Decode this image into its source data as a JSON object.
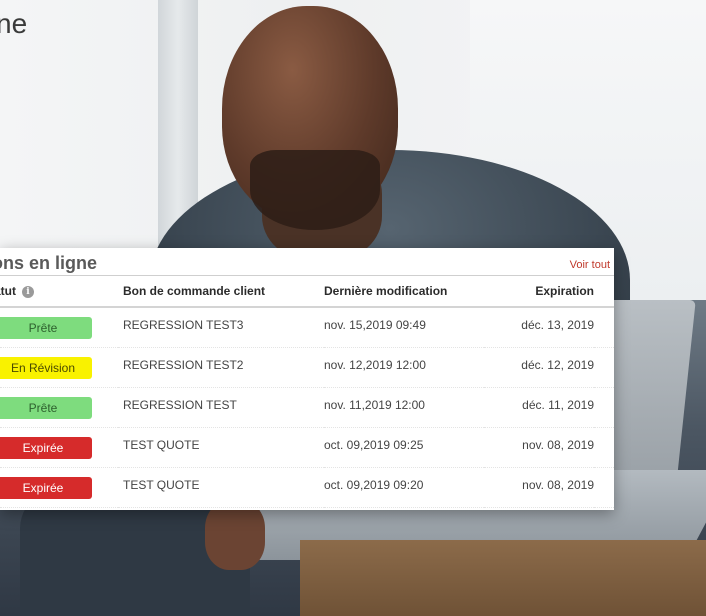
{
  "page": {
    "heading_fragment": "ne"
  },
  "panel": {
    "title": "ons en ligne",
    "view_all": "Voir tout",
    "columns": {
      "status": "tatut",
      "order": "Bon de commande client",
      "modified": "Dernière modification",
      "expiration": "Expiration"
    },
    "rows": [
      {
        "status": "Prête",
        "status_color": "#7edc7e",
        "order": "REGRESSION TEST3",
        "modified": "nov. 15,2019 09:49",
        "expiration": "déc. 13, 2019"
      },
      {
        "status": "En Révision",
        "status_color": "#f9f200",
        "order": "REGRESSION TEST2",
        "modified": "nov. 12,2019 12:00",
        "expiration": "déc. 12, 2019"
      },
      {
        "status": "Prête",
        "status_color": "#7edc7e",
        "order": "REGRESSION TEST",
        "modified": "nov. 11,2019 12:00",
        "expiration": "déc. 11, 2019"
      },
      {
        "status": "Expirée",
        "status_color": "#d62b2b",
        "order": "TEST QUOTE",
        "modified": "oct. 09,2019 09:25",
        "expiration": "nov. 08, 2019"
      },
      {
        "status": "Expirée",
        "status_color": "#d62b2b",
        "order": "TEST QUOTE",
        "modified": "oct. 09,2019 09:20",
        "expiration": "nov. 08, 2019"
      }
    ]
  },
  "icons": {
    "info": "info-icon"
  },
  "colors": {
    "link": "#c0392b",
    "ready": "#7edc7e",
    "review": "#f9f200",
    "expired": "#d62b2b"
  }
}
